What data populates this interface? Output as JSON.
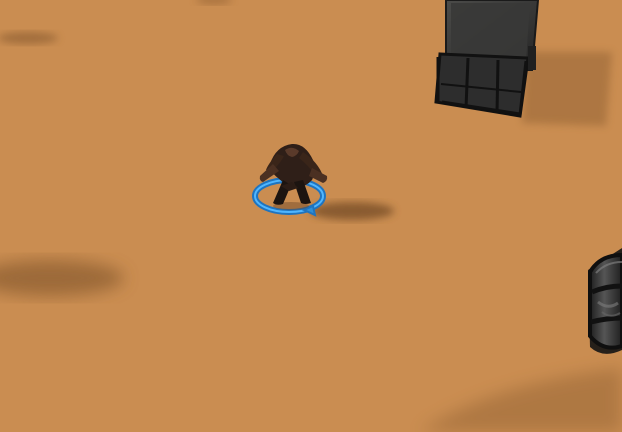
{
  "scene": {
    "ground": "desert-sand",
    "player": {
      "icon": "player-character-icon",
      "selection_ring_color": "#2f8fd6"
    },
    "objects": [
      {
        "icon": "hay-cart-icon"
      },
      {
        "icon": "barrel-icon"
      }
    ]
  }
}
